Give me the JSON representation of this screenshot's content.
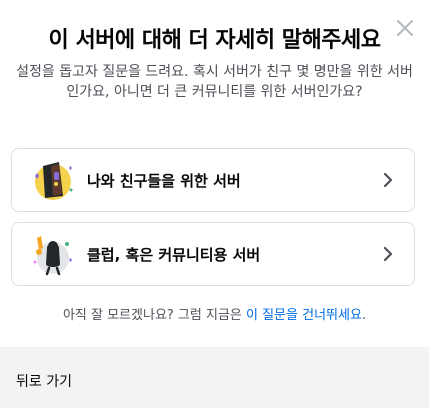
{
  "modal": {
    "title": "이 서버에 대해 더 자세히 말해주세요",
    "description": "설정을 돕고자 질문을 드려요. 혹시 서버가 친구 몇 명만을 위한 서버인가요, 아니면 더 큰 커뮤니티를 위한 서버인가요?",
    "close_icon": "close-icon"
  },
  "options": [
    {
      "label": "나와 친구들을 위한 서버",
      "icon": "friends-illustration-icon"
    },
    {
      "label": "클럽, 혹은 커뮤니티용 서버",
      "icon": "community-illustration-icon"
    }
  ],
  "skip": {
    "prefix": "아직 잘 모르겠나요? 그럼 지금은 ",
    "link": "이 질문을 건너뛰세요",
    "suffix": "."
  },
  "footer": {
    "back_label": "뒤로 가기"
  },
  "colors": {
    "link": "#006ce7",
    "footer_bg": "#f2f3f5",
    "border": "#dcdee1",
    "muted_text": "#4e5058"
  }
}
